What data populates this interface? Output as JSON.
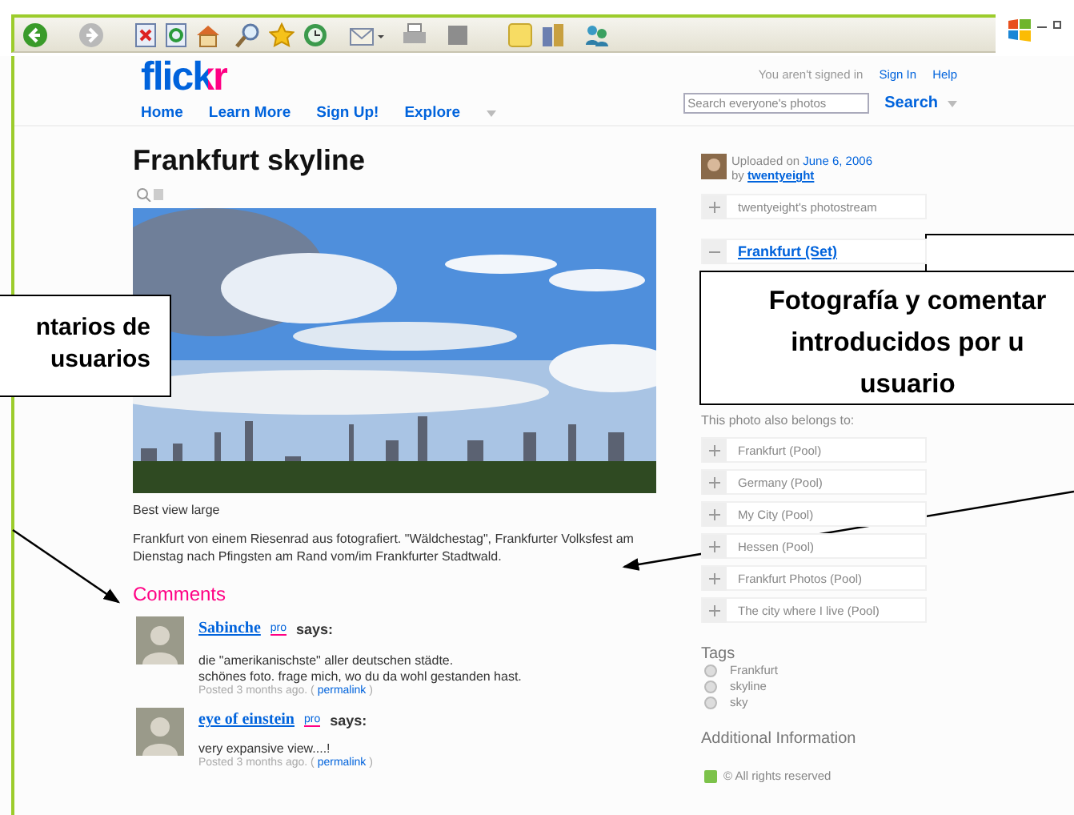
{
  "header": {
    "logo": "flickr",
    "nav": [
      "Home",
      "Learn More",
      "Sign Up!",
      "Explore"
    ],
    "signin_status": "You aren't signed in",
    "links": [
      "Sign In",
      "Help"
    ],
    "search": {
      "placeholder": "Search everyone's photos",
      "button": "Search"
    }
  },
  "photo": {
    "title": "Frankfurt skyline",
    "caption": "Best view large",
    "description": "Frankfurt von einem Riesenrad aus fotografiert. \"Wäldchestag\", Frankfurter Volksfest am Dienstag nach Pfingsten am Rand vom/im Frankfurter Stadtwald."
  },
  "comments": {
    "heading": "Comments",
    "items": [
      {
        "author": "Sabinche",
        "badge": "pro",
        "says": "says:",
        "lines": [
          "die \"amerikanischste\" aller deutschen städte.",
          "schönes foto. frage mich, wo du da wohl gestanden hast."
        ],
        "posted": "Posted 3 months ago. (",
        "permalink": "permalink",
        "close": ")"
      },
      {
        "author": "eye of einstein",
        "badge": "pro",
        "says": "says:",
        "lines": [
          "very expansive view....!"
        ],
        "posted": "Posted 3 months ago. (",
        "permalink": "permalink",
        "close": ")"
      }
    ]
  },
  "sidebar": {
    "uploaded": "Uploaded on",
    "date": "June 6, 2006",
    "by": "by",
    "user": "twentyeight",
    "photostream": "twentyeight's photostream",
    "set": "Frankfurt (Set)",
    "also_belongs": "This photo also belongs to:",
    "pools": [
      "Frankfurt (Pool)",
      "Germany (Pool)",
      "My City (Pool)",
      "Hessen (Pool)",
      "Frankfurt Photos (Pool)",
      "The city where I live (Pool)"
    ],
    "tags_heading": "Tags",
    "tags": [
      "Frankfurt",
      "skyline",
      "sky"
    ],
    "additional_heading": "Additional Information",
    "rights": "© All rights reserved"
  },
  "annotations": [
    {
      "lines": [
        "ntarios de",
        "usuarios"
      ]
    },
    {
      "lines": [
        "Fotografía y comentar",
        "introducidos por u",
        "usuario"
      ]
    }
  ]
}
